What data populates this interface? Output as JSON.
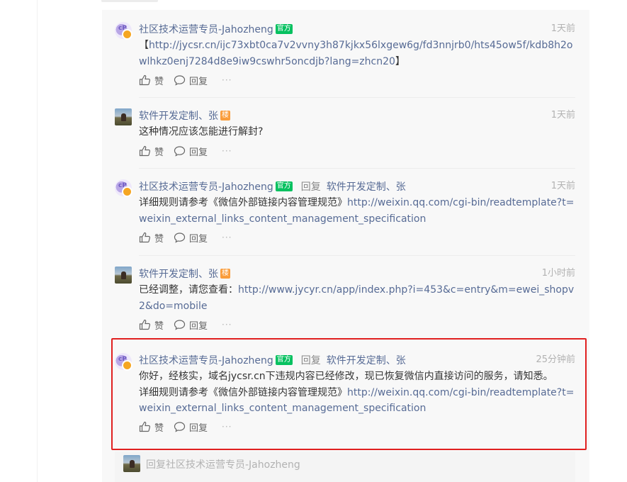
{
  "comments": [
    {
      "avatar_type": "official-avatar",
      "author": "社区技术运营专员-Jahozheng",
      "badge": "官方",
      "badge_color": "#07c160",
      "time": "1天前",
      "content_prefix": "【",
      "content_link": "http://jycsr.cn/ijc73xbt0ca7v2vvny3h87kjkx56lxgew6g/fd3nnjrb0/hts45ow5f/kdb8h2owlhkz0enj7284d8e9iw9cswhr5oncdjb?lang=zhcn20",
      "content_suffix": "】",
      "like_label": "赞",
      "reply_label": "回复",
      "more": "···"
    },
    {
      "avatar_type": "user-avatar",
      "author": "软件开发定制、张",
      "badge": "楼",
      "badge_color": "#fa9d3b",
      "time": "1天前",
      "content_text": "这种情况应该怎能进行解封?",
      "like_label": "赞",
      "reply_label": "回复",
      "more": "···"
    },
    {
      "avatar_type": "official-avatar",
      "author": "社区技术运营专员-Jahozheng",
      "badge": "官方",
      "badge_color": "#07c160",
      "reply_word": "回复",
      "reply_target": "软件开发定制、张",
      "time": "1天前",
      "content_text": "详细规则请参考《微信外部链接内容管理规范》",
      "content_link": "http://weixin.qq.com/cgi-bin/readtemplate?t=weixin_external_links_content_management_specification",
      "like_label": "赞",
      "reply_label": "回复",
      "more": "···"
    },
    {
      "avatar_type": "user-avatar",
      "author": "软件开发定制、张",
      "badge": "楼",
      "badge_color": "#fa9d3b",
      "time": "1小时前",
      "content_text": "已经调整，请您查看：",
      "content_link": "http://www.jycyr.cn/app/index.php?i=453&c=entry&m=ewei_shopv2&do=mobile",
      "like_label": "赞",
      "reply_label": "回复",
      "more": "···"
    },
    {
      "avatar_type": "official-avatar",
      "author": "社区技术运营专员-Jahozheng",
      "badge": "官方",
      "badge_color": "#07c160",
      "reply_word": "回复",
      "reply_target": "软件开发定制、张",
      "time": "25分钟前",
      "content_line1": "你好，经核实，域名jycsr.cn下违规内容已经修改，现已恢复微信内直接访问的服务，请知悉。",
      "content_text": "详细规则请参考《微信外部链接内容管理规范》",
      "content_link": "http://weixin.qq.com/cgi-bin/readtemplate?t=weixin_external_links_content_management_specification",
      "like_label": "赞",
      "reply_label": "回复",
      "more": "···"
    }
  ],
  "reply_box": {
    "placeholder": "回复社区技术运营专员-Jahozheng"
  },
  "colors": {
    "link": "#576b95",
    "highlight_border": "#e02020"
  }
}
